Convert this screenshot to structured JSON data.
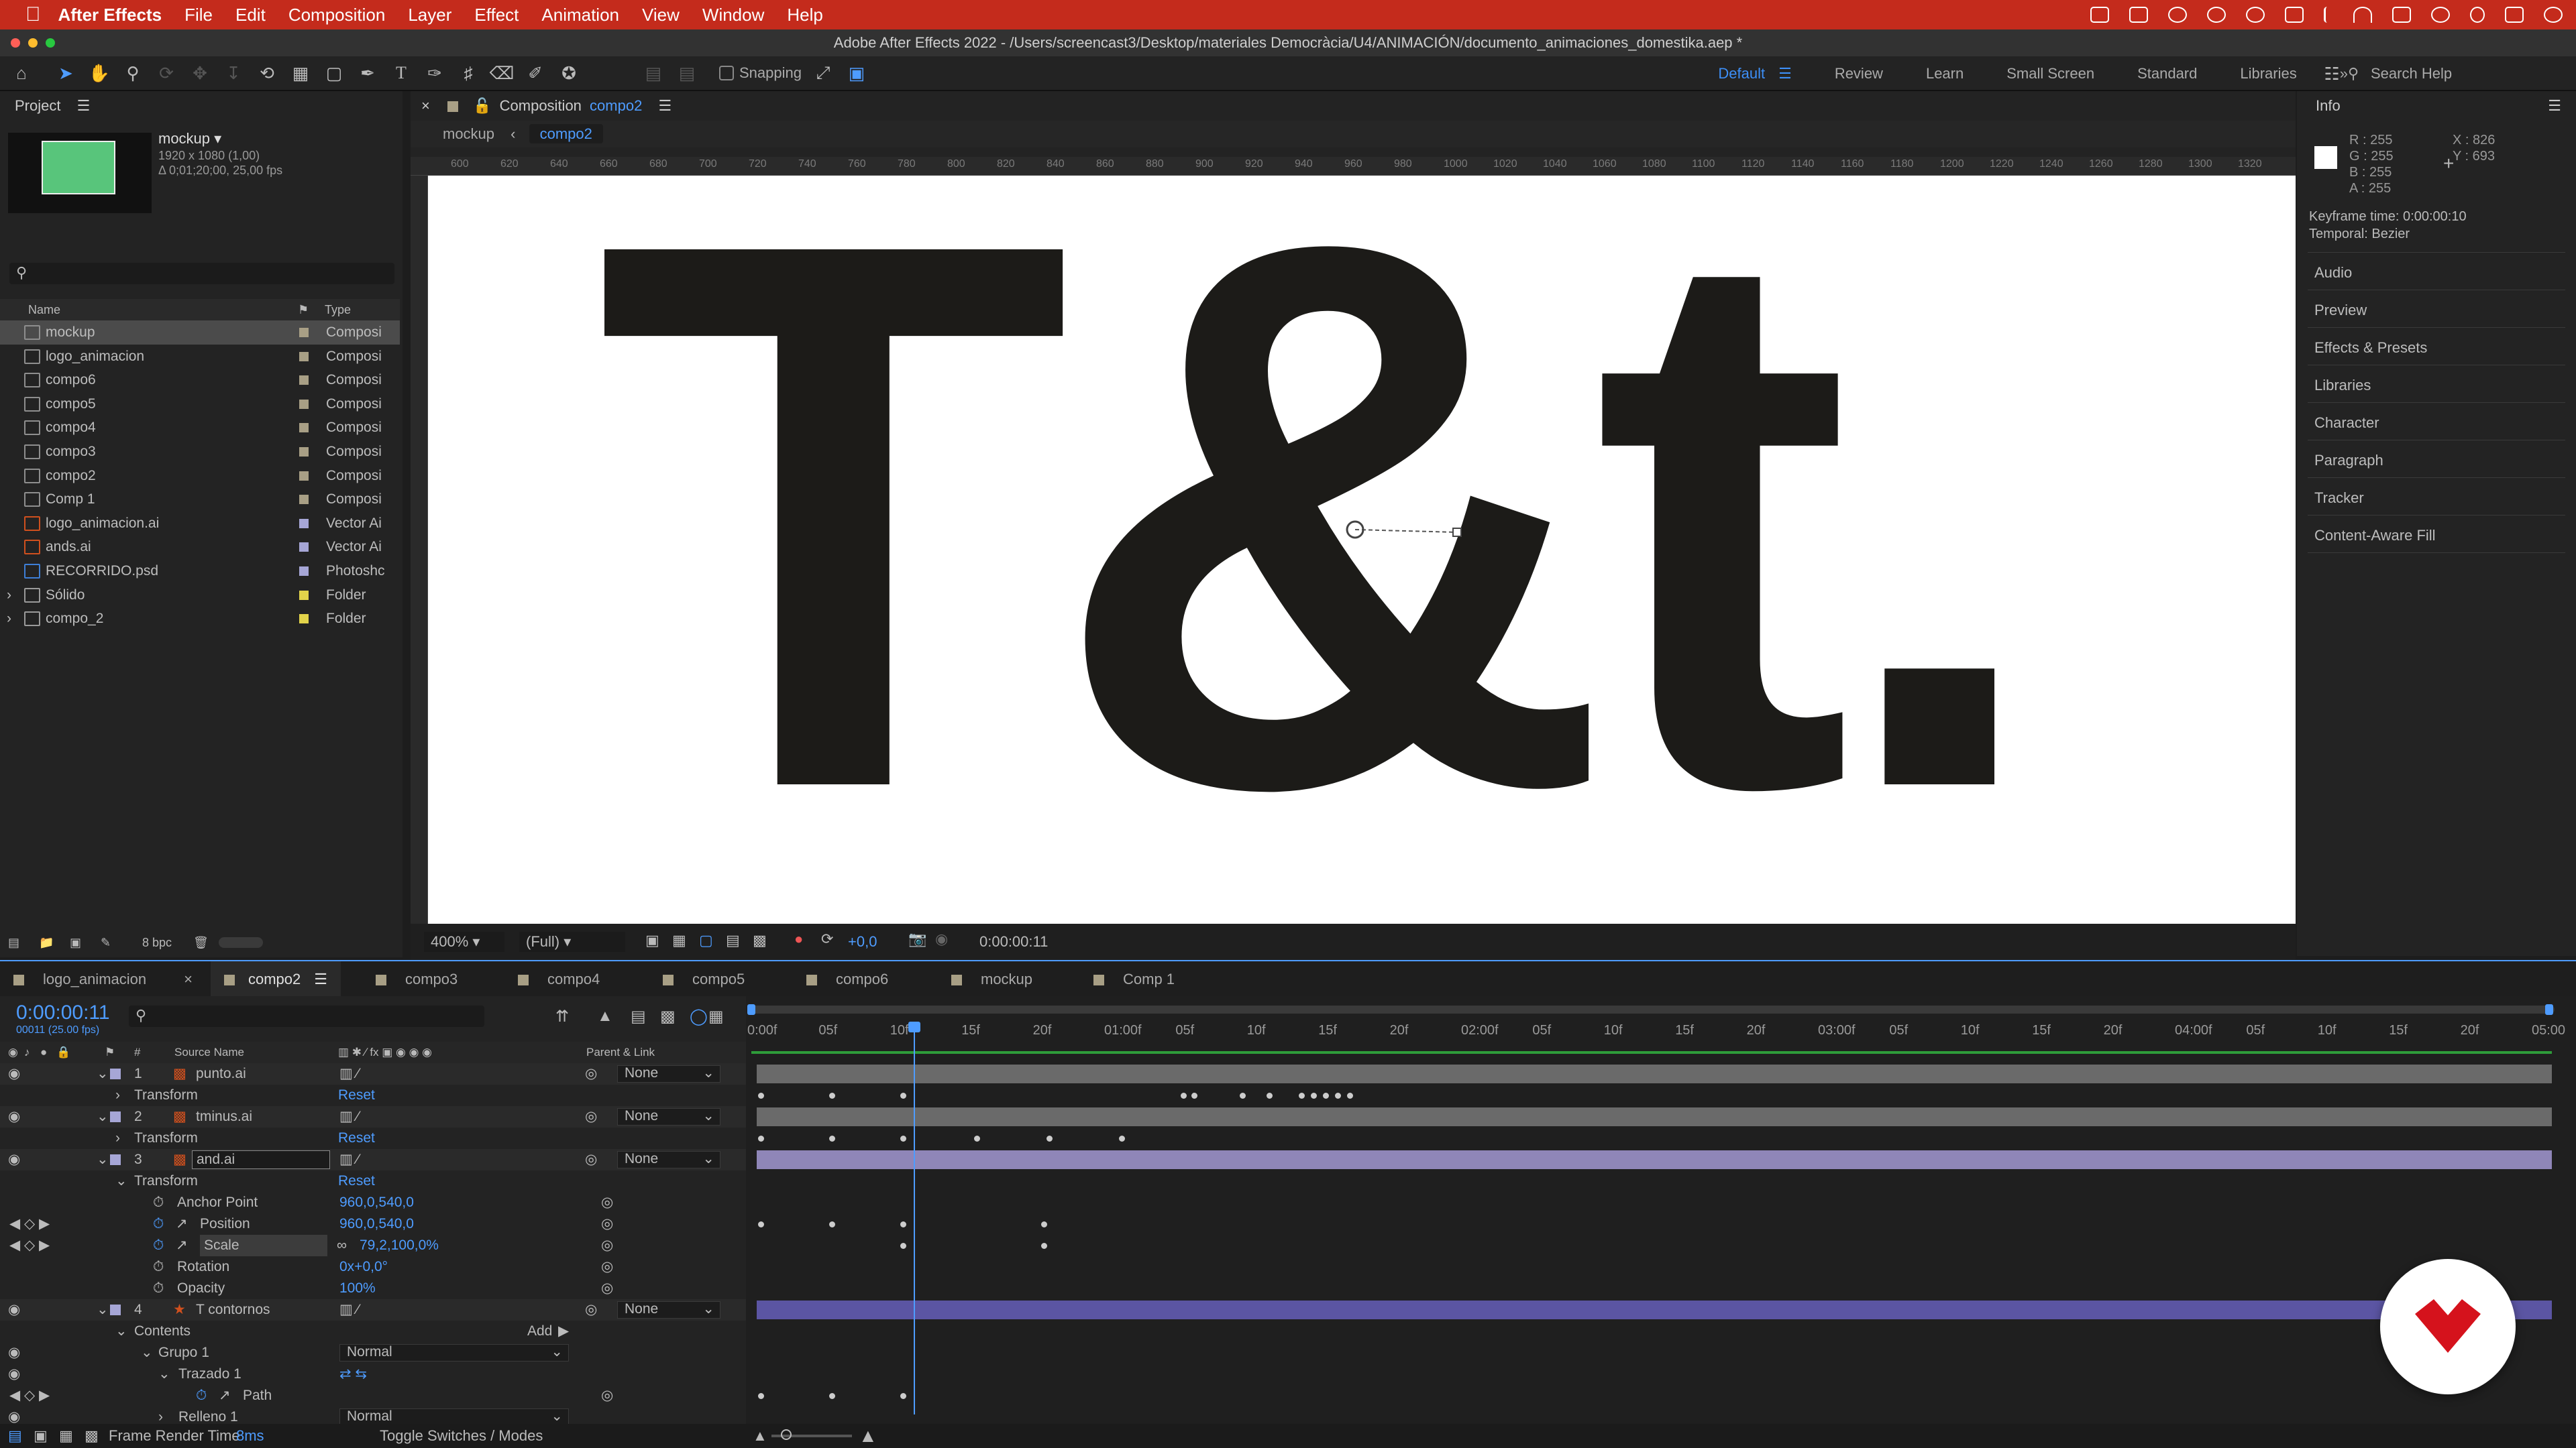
{
  "menubar": {
    "app_name": "After Effects",
    "items": [
      "File",
      "Edit",
      "Composition",
      "Layer",
      "Effect",
      "Animation",
      "View",
      "Window",
      "Help"
    ]
  },
  "window_title": "Adobe After Effects 2022 - /Users/screencast3/Desktop/materiales Democràcia/U4/ANIMACIÓN/documento_animaciones_domestika.aep *",
  "toolbar": {
    "snapping_label": "Snapping",
    "workspaces": [
      "Default",
      "Review",
      "Learn",
      "Small Screen",
      "Standard",
      "Libraries"
    ],
    "active_workspace": "Default",
    "search_placeholder": "Search Help"
  },
  "project": {
    "title": "Project",
    "selected_name": "mockup ▾",
    "selected_info1": "1920 x 1080 (1,00)",
    "selected_info2": "Δ 0;01;20;00, 25,00 fps",
    "col_name": "Name",
    "col_type": "Type",
    "bpc": "8 bpc",
    "items": [
      {
        "name": "mockup",
        "type": "Composi",
        "color": "#a89f85",
        "kind": "comp",
        "selected": true
      },
      {
        "name": "logo_animacion",
        "type": "Composi",
        "color": "#a89f85",
        "kind": "comp"
      },
      {
        "name": "compo6",
        "type": "Composi",
        "color": "#a89f85",
        "kind": "comp"
      },
      {
        "name": "compo5",
        "type": "Composi",
        "color": "#a89f85",
        "kind": "comp"
      },
      {
        "name": "compo4",
        "type": "Composi",
        "color": "#a89f85",
        "kind": "comp"
      },
      {
        "name": "compo3",
        "type": "Composi",
        "color": "#a89f85",
        "kind": "comp"
      },
      {
        "name": "compo2",
        "type": "Composi",
        "color": "#a89f85",
        "kind": "comp"
      },
      {
        "name": "Comp 1",
        "type": "Composi",
        "color": "#a89f85",
        "kind": "comp"
      },
      {
        "name": "logo_animacion.ai",
        "type": "Vector Ai",
        "color": "#a6a6d6",
        "kind": "ai"
      },
      {
        "name": "ands.ai",
        "type": "Vector Ai",
        "color": "#a6a6d6",
        "kind": "ai"
      },
      {
        "name": "RECORRIDO.psd",
        "type": "Photoshc",
        "color": "#a6a6d6",
        "kind": "psd"
      },
      {
        "name": "Sólido",
        "type": "Folder",
        "color": "#e2d34a",
        "kind": "folder"
      },
      {
        "name": "compo_2",
        "type": "Folder",
        "color": "#e2d34a",
        "kind": "folder"
      }
    ]
  },
  "composition": {
    "tab_label": "Composition",
    "tab_name": "compo2",
    "breadcrumb": [
      "mockup",
      "compo2"
    ],
    "zoom": "400%",
    "resolution": "(Full)",
    "exposure": "+0,0",
    "timecode": "0:00:00:11",
    "ruler_marks": [
      "600",
      "620",
      "640",
      "660",
      "680",
      "700",
      "720",
      "740",
      "760",
      "780",
      "800",
      "820",
      "840",
      "860",
      "880",
      "900",
      "920",
      "940",
      "960",
      "980",
      "1000",
      "1020",
      "1040",
      "1060",
      "1080",
      "1100",
      "1120",
      "1140",
      "1160",
      "1180",
      "1200",
      "1220",
      "1240",
      "1260",
      "1280",
      "1300",
      "1320"
    ],
    "artwork_text": "T&t."
  },
  "info": {
    "title": "Info",
    "r": "R : 255",
    "g": "G : 255",
    "b": "B : 255",
    "a": "A : 255",
    "x": "X : 826",
    "y": "Y : 693",
    "keyframe_time": "Keyframe time: 0:00:00:10",
    "temporal": "Temporal: Bezier",
    "panels": [
      "Audio",
      "Preview",
      "Effects & Presets",
      "Libraries",
      "Character",
      "Paragraph",
      "Tracker",
      "Content-Aware Fill"
    ]
  },
  "timeline": {
    "tabs": [
      "logo_animacion",
      "compo2",
      "compo3",
      "compo4",
      "compo5",
      "compo6",
      "mockup",
      "Comp 1"
    ],
    "active_tab": "compo2",
    "timecode": "0:00:00:11",
    "frame_info": "00011 (25.00 fps)",
    "col_source": "Source Name",
    "col_parent": "Parent & Link",
    "time_ruler": [
      "0:00f",
      "05f",
      "10f",
      "15f",
      "20f",
      "01:00f",
      "05f",
      "10f",
      "15f",
      "20f",
      "02:00f",
      "05f",
      "10f",
      "15f",
      "20f",
      "03:00f",
      "05f",
      "10f",
      "15f",
      "20f",
      "04:00f",
      "05f",
      "10f",
      "15f",
      "20f",
      "05:00"
    ],
    "layers": [
      {
        "num": "1",
        "name": "punto.ai",
        "parent": "None"
      },
      {
        "num": "2",
        "name": "tminus.ai",
        "parent": "None"
      },
      {
        "num": "3",
        "name": "and.ai",
        "parent": "None"
      },
      {
        "num": "4",
        "name": "T contornos",
        "parent": "None"
      }
    ],
    "transform_label": "Transform",
    "reset_label": "Reset",
    "properties": [
      {
        "name": "Anchor Point",
        "value": "960,0,540,0"
      },
      {
        "name": "Position",
        "value": "960,0,540,0"
      },
      {
        "name": "Scale",
        "value": "79,2,100,0%"
      },
      {
        "name": "Rotation",
        "value": "0x+0,0°"
      },
      {
        "name": "Opacity",
        "value": "100%"
      }
    ],
    "contents_label": "Contents",
    "add_label": "Add",
    "group_label": "Grupo 1",
    "blend_mode": "Normal",
    "trazado_label": "Trazado 1",
    "path_label": "Path",
    "relleno_label": "Relleno 1",
    "relleno_mode": "Normal",
    "frame_render_label": "Frame Render Time",
    "frame_render_value": "8ms",
    "toggle_label": "Toggle Switches / Modes"
  },
  "colors": {
    "accent": "#4e9cff",
    "menubar": "#c42b1c",
    "logo": "#d5121c"
  }
}
